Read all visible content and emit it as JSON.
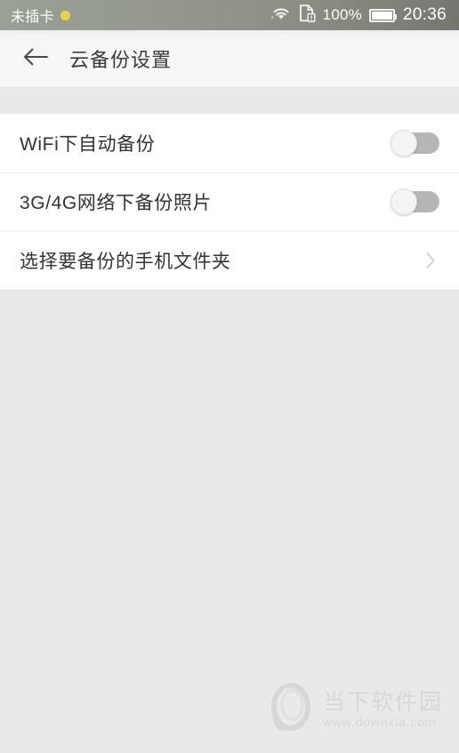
{
  "status_bar": {
    "sim_text": "未插卡",
    "sim_dot_icon": "dot-indicator-icon",
    "wifi_icon": "wifi-icon",
    "sd_card_icon": "sd-card-warning-icon",
    "battery_percent": "100%",
    "battery_icon": "battery-full-icon",
    "clock": "20:36",
    "colors": {
      "background_start": "#9aa096",
      "background_end": "#73766e",
      "text": "#ffffff",
      "sim_dot": "#e8d24a"
    }
  },
  "app_bar": {
    "back_icon": "arrow-left-icon",
    "title": "云备份设置",
    "colors": {
      "background": "#f7f7f7",
      "title_text": "#3b3b3b"
    }
  },
  "settings": {
    "rows": [
      {
        "label": "WiFi下自动备份",
        "control": "switch",
        "state": "off"
      },
      {
        "label": "3G/4G网络下备份照片",
        "control": "switch",
        "state": "off"
      },
      {
        "label": "选择要备份的手机文件夹",
        "control": "chevron",
        "chevron_icon": "chevron-right-icon"
      }
    ],
    "colors": {
      "card_background": "#ffffff",
      "label_text": "#333333",
      "divider": "#f2f2f2",
      "switch_track_off": "#b6b6b6",
      "switch_knob": "#f4f4f4",
      "chevron": "#cfcfcf"
    }
  },
  "page": {
    "background": "#e9e9e9"
  },
  "watermark": {
    "logo_icon": "downxia-logo-icon",
    "name": "当下软件园",
    "url": "www.downxia.com",
    "color": "#c9c9c9"
  }
}
